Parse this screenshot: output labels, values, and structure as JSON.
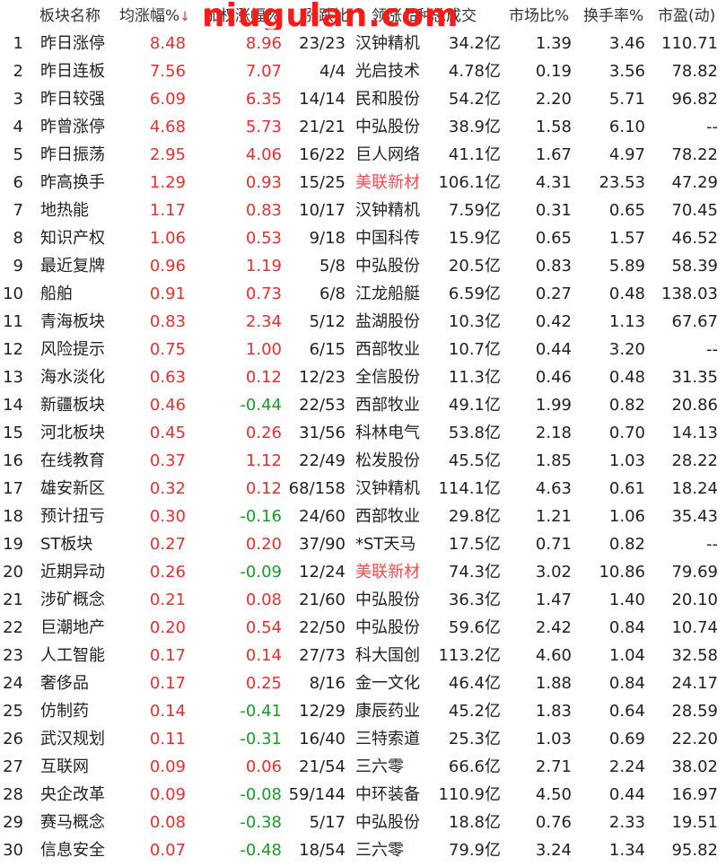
{
  "header": {
    "idx": "",
    "name": "板块名称",
    "avg": "均涨幅%",
    "weighted": "加权涨幅%",
    "count": "涨跌比",
    "lead": "领涨品种",
    "amount": "总成交",
    "market_share": "市场比%",
    "turnover": "换手率%",
    "pe": "市盈(动)"
  },
  "sort_arrow": "↓",
  "watermark": "niugulan.com",
  "colors": {
    "up": "#e83030",
    "down": "#1a9a2a",
    "highlight": "#f05050",
    "header_border": "#7fb5c9"
  },
  "rows": [
    {
      "idx": "1",
      "name": "昨日涨停",
      "avg": "8.48",
      "w": "8.96",
      "wdir": "up",
      "cnt": "23/23",
      "lead": "汉钟精机",
      "amt": "34.2亿",
      "mkt": "1.39",
      "turn": "3.46",
      "pe": "110.71"
    },
    {
      "idx": "2",
      "name": "昨日连板",
      "avg": "7.56",
      "w": "7.07",
      "wdir": "up",
      "cnt": "4/4",
      "lead": "光启技术",
      "amt": "4.78亿",
      "mkt": "0.19",
      "turn": "3.56",
      "pe": "78.82"
    },
    {
      "idx": "3",
      "name": "昨日较强",
      "avg": "6.09",
      "w": "6.35",
      "wdir": "up",
      "cnt": "14/14",
      "lead": "民和股份",
      "amt": "54.2亿",
      "mkt": "2.20",
      "turn": "5.71",
      "pe": "96.82"
    },
    {
      "idx": "4",
      "name": "昨曾涨停",
      "avg": "4.68",
      "w": "5.73",
      "wdir": "up",
      "cnt": "21/21",
      "lead": "中弘股份",
      "amt": "38.9亿",
      "mkt": "1.58",
      "turn": "6.10",
      "pe": "--"
    },
    {
      "idx": "5",
      "name": "昨日振荡",
      "avg": "2.95",
      "w": "4.06",
      "wdir": "up",
      "cnt": "16/22",
      "lead": "巨人网络",
      "amt": "41.1亿",
      "mkt": "1.67",
      "turn": "4.97",
      "pe": "78.22"
    },
    {
      "idx": "6",
      "name": "昨高换手",
      "avg": "1.29",
      "w": "0.93",
      "wdir": "up",
      "cnt": "15/25",
      "lead": "美联新材",
      "lead_hl": true,
      "amt": "106.1亿",
      "mkt": "4.31",
      "turn": "23.53",
      "pe": "47.29"
    },
    {
      "idx": "7",
      "name": "地热能",
      "avg": "1.17",
      "w": "0.83",
      "wdir": "up",
      "cnt": "10/17",
      "lead": "汉钟精机",
      "amt": "7.59亿",
      "mkt": "0.31",
      "turn": "0.65",
      "pe": "70.45"
    },
    {
      "idx": "8",
      "name": "知识产权",
      "avg": "1.06",
      "w": "0.53",
      "wdir": "up",
      "cnt": "9/18",
      "lead": "中国科传",
      "amt": "15.9亿",
      "mkt": "0.65",
      "turn": "1.57",
      "pe": "46.52"
    },
    {
      "idx": "9",
      "name": "最近复牌",
      "avg": "0.96",
      "w": "1.19",
      "wdir": "up",
      "cnt": "5/8",
      "lead": "中弘股份",
      "amt": "20.5亿",
      "mkt": "0.83",
      "turn": "5.89",
      "pe": "58.39"
    },
    {
      "idx": "10",
      "name": "船舶",
      "avg": "0.91",
      "w": "0.73",
      "wdir": "up",
      "cnt": "6/8",
      "lead": "江龙船艇",
      "amt": "6.59亿",
      "mkt": "0.27",
      "turn": "0.48",
      "pe": "138.03"
    },
    {
      "idx": "11",
      "name": "青海板块",
      "avg": "0.83",
      "w": "2.34",
      "wdir": "up",
      "cnt": "5/12",
      "lead": "盐湖股份",
      "amt": "10.3亿",
      "mkt": "0.42",
      "turn": "1.13",
      "pe": "67.67"
    },
    {
      "idx": "12",
      "name": "风险提示",
      "avg": "0.75",
      "w": "1.00",
      "wdir": "up",
      "cnt": "6/15",
      "lead": "西部牧业",
      "amt": "10.7亿",
      "mkt": "0.44",
      "turn": "3.20",
      "pe": "--"
    },
    {
      "idx": "13",
      "name": "海水淡化",
      "avg": "0.63",
      "w": "0.12",
      "wdir": "up",
      "cnt": "12/23",
      "lead": "全信股份",
      "amt": "11.3亿",
      "mkt": "0.46",
      "turn": "0.48",
      "pe": "31.35"
    },
    {
      "idx": "14",
      "name": "新疆板块",
      "avg": "0.46",
      "w": "-0.44",
      "wdir": "down",
      "cnt": "22/53",
      "lead": "西部牧业",
      "amt": "49.1亿",
      "mkt": "1.99",
      "turn": "0.82",
      "pe": "20.86"
    },
    {
      "idx": "15",
      "name": "河北板块",
      "avg": "0.45",
      "w": "0.26",
      "wdir": "up",
      "cnt": "31/56",
      "lead": "科林电气",
      "amt": "53.8亿",
      "mkt": "2.18",
      "turn": "0.70",
      "pe": "14.13"
    },
    {
      "idx": "16",
      "name": "在线教育",
      "avg": "0.37",
      "w": "1.12",
      "wdir": "up",
      "cnt": "22/49",
      "lead": "松发股份",
      "amt": "45.5亿",
      "mkt": "1.85",
      "turn": "1.03",
      "pe": "28.22"
    },
    {
      "idx": "17",
      "name": "雄安新区",
      "avg": "0.32",
      "w": "0.12",
      "wdir": "up",
      "cnt": "68/158",
      "lead": "汉钟精机",
      "amt": "114.1亿",
      "mkt": "4.63",
      "turn": "0.61",
      "pe": "18.24"
    },
    {
      "idx": "18",
      "name": "预计扭亏",
      "avg": "0.30",
      "w": "-0.16",
      "wdir": "down",
      "cnt": "24/60",
      "lead": "西部牧业",
      "amt": "29.8亿",
      "mkt": "1.21",
      "turn": "1.06",
      "pe": "35.43"
    },
    {
      "idx": "19",
      "name": "ST板块",
      "avg": "0.27",
      "w": "0.20",
      "wdir": "up",
      "cnt": "37/90",
      "lead": "*ST天马",
      "amt": "17.5亿",
      "mkt": "0.71",
      "turn": "0.82",
      "pe": "--"
    },
    {
      "idx": "20",
      "name": "近期异动",
      "avg": "0.26",
      "w": "-0.09",
      "wdir": "down",
      "cnt": "12/24",
      "lead": "美联新材",
      "lead_hl": true,
      "amt": "74.3亿",
      "mkt": "3.02",
      "turn": "10.86",
      "pe": "79.69"
    },
    {
      "idx": "21",
      "name": "涉矿概念",
      "avg": "0.21",
      "w": "0.08",
      "wdir": "up",
      "cnt": "21/60",
      "lead": "中弘股份",
      "amt": "36.3亿",
      "mkt": "1.47",
      "turn": "1.40",
      "pe": "20.10"
    },
    {
      "idx": "22",
      "name": "巨潮地产",
      "avg": "0.20",
      "w": "0.54",
      "wdir": "up",
      "cnt": "22/50",
      "lead": "中弘股份",
      "amt": "59.6亿",
      "mkt": "2.42",
      "turn": "0.84",
      "pe": "10.74"
    },
    {
      "idx": "23",
      "name": "人工智能",
      "avg": "0.17",
      "w": "0.14",
      "wdir": "up",
      "cnt": "27/73",
      "lead": "科大国创",
      "amt": "113.2亿",
      "mkt": "4.60",
      "turn": "1.04",
      "pe": "32.58"
    },
    {
      "idx": "24",
      "name": "奢侈品",
      "avg": "0.17",
      "w": "0.25",
      "wdir": "up",
      "cnt": "8/16",
      "lead": "金一文化",
      "amt": "46.4亿",
      "mkt": "1.88",
      "turn": "0.84",
      "pe": "24.17"
    },
    {
      "idx": "25",
      "name": "仿制药",
      "avg": "0.14",
      "w": "-0.41",
      "wdir": "down",
      "cnt": "12/29",
      "lead": "康辰药业",
      "amt": "45.2亿",
      "mkt": "1.83",
      "turn": "0.64",
      "pe": "28.59"
    },
    {
      "idx": "26",
      "name": "武汉规划",
      "avg": "0.11",
      "w": "-0.31",
      "wdir": "down",
      "cnt": "16/40",
      "lead": "三特索道",
      "amt": "25.3亿",
      "mkt": "1.03",
      "turn": "0.69",
      "pe": "22.20"
    },
    {
      "idx": "27",
      "name": "互联网",
      "avg": "0.09",
      "w": "0.06",
      "wdir": "up",
      "cnt": "21/54",
      "lead": "三六零",
      "amt": "66.6亿",
      "mkt": "2.71",
      "turn": "2.24",
      "pe": "38.02"
    },
    {
      "idx": "28",
      "name": "央企改革",
      "avg": "0.09",
      "w": "-0.08",
      "wdir": "down",
      "cnt": "59/144",
      "lead": "中环装备",
      "amt": "110.9亿",
      "mkt": "4.50",
      "turn": "0.44",
      "pe": "16.97"
    },
    {
      "idx": "29",
      "name": "赛马概念",
      "avg": "0.08",
      "w": "-0.38",
      "wdir": "down",
      "cnt": "5/17",
      "lead": "中弘股份",
      "amt": "18.8亿",
      "mkt": "0.76",
      "turn": "2.33",
      "pe": "19.51"
    },
    {
      "idx": "30",
      "name": "信息安全",
      "avg": "0.07",
      "w": "-0.48",
      "wdir": "down",
      "cnt": "18/54",
      "lead": "三六零",
      "amt": "79.9亿",
      "mkt": "3.24",
      "turn": "1.34",
      "pe": "95.82"
    }
  ]
}
